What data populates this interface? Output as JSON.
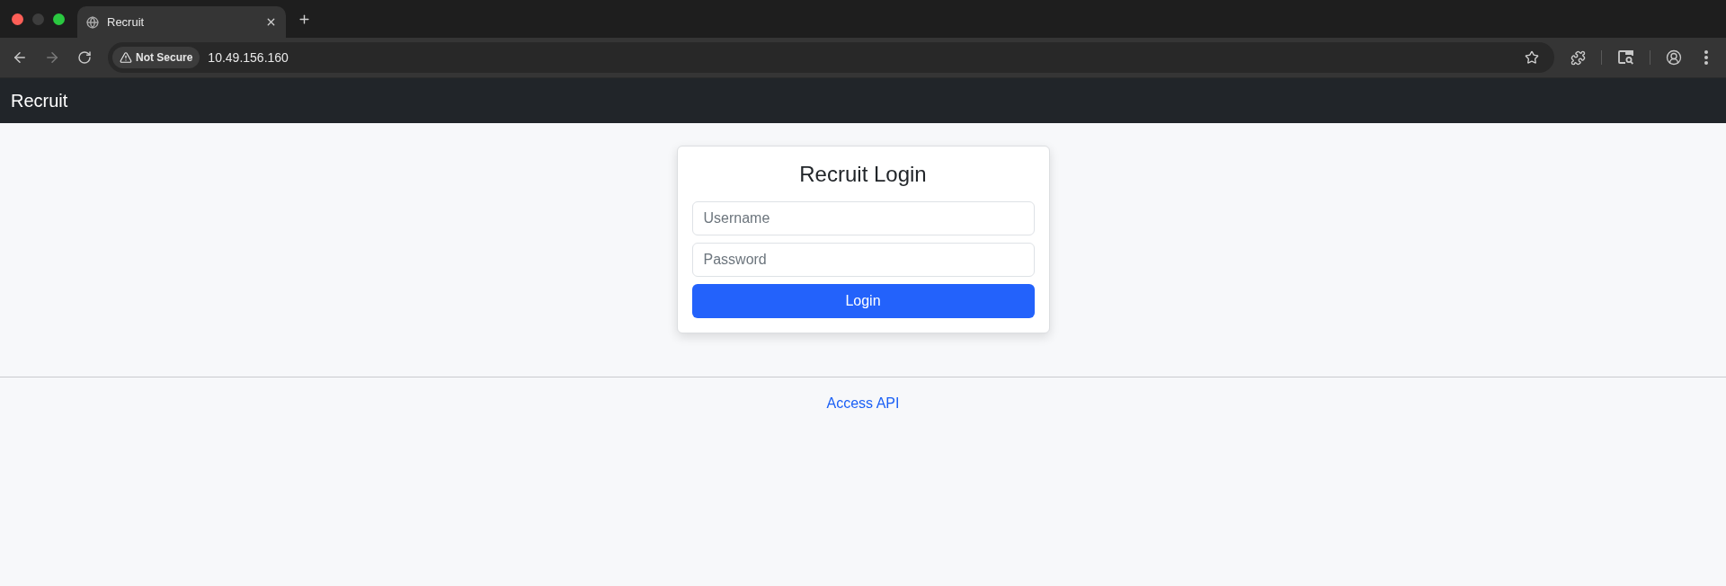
{
  "browser": {
    "tab": {
      "title": "Recruit"
    },
    "nav_buttons": [
      {
        "kind": "back",
        "disabled": false
      },
      {
        "kind": "forward",
        "disabled": true
      },
      {
        "kind": "reload",
        "disabled": false
      }
    ],
    "address_bar": {
      "security_label": "Not Secure",
      "url": "10.49.156.160"
    }
  },
  "navbar": {
    "brand": "Recruit"
  },
  "login_card": {
    "title": "Recruit Login",
    "fields": [
      {
        "placeholder": "Username"
      },
      {
        "placeholder": "Password"
      }
    ],
    "submit_button": "Login"
  },
  "footer": {
    "link": "Access API"
  }
}
